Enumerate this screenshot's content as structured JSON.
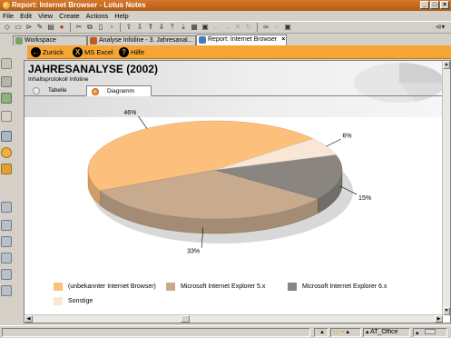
{
  "window": {
    "title": "Report: Internet Browser - Lotus Notes",
    "controls": [
      "_",
      "□",
      "×"
    ]
  },
  "menu": [
    "File",
    "Edit",
    "View",
    "Create",
    "Actions",
    "Help"
  ],
  "toolbar": {
    "icons": [
      "search-doc-icon",
      "new-doc-icon",
      "open-icon",
      "edit-icon",
      "print-icon",
      "color-icon",
      "cut-icon",
      "copy-icon",
      "paste-icon",
      "attach-icon",
      "nav-up-icon",
      "nav-down-icon",
      "nav-prev-icon",
      "nav-next-icon",
      "nav-first-icon",
      "nav-last-icon",
      "view-icon",
      "refresh-icon",
      "back-icon",
      "forward-icon",
      "binoculars-icon",
      "search-icon",
      "floppy-icon"
    ]
  },
  "tabs": [
    {
      "label": "Workspace",
      "icon": "workspace-icon",
      "closable": false
    },
    {
      "label": "Analyse Infoline - 3. Jahresanal...",
      "icon": "database-icon",
      "closable": true
    },
    {
      "label": "Report: Internet Browser",
      "icon": "report-icon",
      "closable": true,
      "active": true
    }
  ],
  "actions": [
    {
      "label": "Zurück",
      "icon": "back-arrow-icon",
      "glyph": "←"
    },
    {
      "label": "MS Excel",
      "icon": "excel-icon",
      "glyph": "X"
    },
    {
      "label": "Hilfe",
      "icon": "help-icon",
      "glyph": "?"
    }
  ],
  "header": {
    "title": "JAHRESANALYSE (2002)",
    "subtitle": "Inhaltsprotokoll Infoline"
  },
  "view_tabs": [
    {
      "label": "Tabelle",
      "active": false
    },
    {
      "label": "Diagramm",
      "active": true
    }
  ],
  "chart_data": {
    "type": "pie",
    "title": "",
    "categories": [
      "(unbekannter Internet Browser)",
      "Microsoft Internet Explorer 5.x",
      "Microsoft Internet Explorer 6.x",
      "Sonstige"
    ],
    "values": [
      46,
      33,
      15,
      6
    ],
    "labels": [
      "46%",
      "33%",
      "15%",
      "6%"
    ],
    "colors": [
      "#fcc07c",
      "#c8aa8e",
      "#8a8580",
      "#f8e7d6"
    ],
    "legend_position": "bottom"
  },
  "statusbar": {
    "location": "AT_Office"
  },
  "colors": {
    "title_bar": "#c8661e",
    "action_bar": "#f4a533",
    "window_bg": "#d4d0c8"
  }
}
